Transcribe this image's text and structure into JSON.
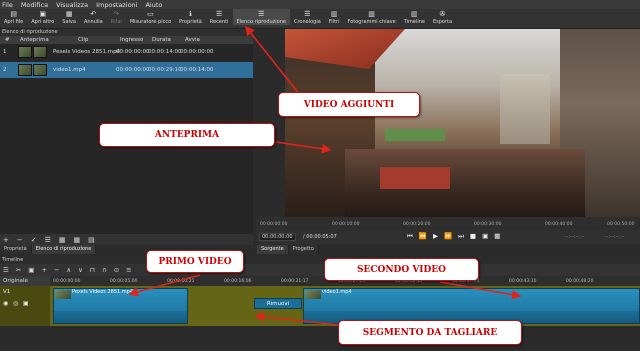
{
  "menu": [
    "File",
    "Modifica",
    "Visualizza",
    "Impostazioni",
    "Aiuto"
  ],
  "toolbar": [
    {
      "icon": "▤",
      "label": "Apri file",
      "name": "open-file-button"
    },
    {
      "icon": "▣",
      "label": "Apri altro",
      "name": "open-other-button"
    },
    {
      "icon": "▦",
      "label": "Salva",
      "name": "save-button"
    },
    {
      "icon": "↶",
      "label": "Annulla",
      "name": "undo-button"
    },
    {
      "icon": "↷",
      "label": "Rifai",
      "name": "redo-button"
    },
    {
      "icon": "▭",
      "label": "Misuratore picco",
      "name": "peak-meter-button"
    },
    {
      "icon": "ℹ",
      "label": "Proprietà",
      "name": "properties-button"
    },
    {
      "icon": "☰",
      "label": "Recenti",
      "name": "recent-button"
    },
    {
      "icon": "☰",
      "label": "Elenco riproduzione",
      "name": "playlist-button"
    },
    {
      "icon": "☰",
      "label": "Cronologia",
      "name": "history-button"
    },
    {
      "icon": "▥",
      "label": "Filtri",
      "name": "filters-button"
    },
    {
      "icon": "▥",
      "label": "Fotogrammi chiave",
      "name": "keyframes-button"
    },
    {
      "icon": "▥",
      "label": "Timeline",
      "name": "timeline-button"
    },
    {
      "icon": "✇",
      "label": "Esporta",
      "name": "export-button"
    }
  ],
  "playlist": {
    "title": "Elenco di riproduzione",
    "headers": {
      "num": "#",
      "thumb": "Anteprima",
      "clip": "Clip",
      "in": "Ingresso",
      "dur": "Durata",
      "start": "Avvia"
    },
    "rows": [
      {
        "num": "1",
        "clip": "Pexels Videos 2851.mp4",
        "in": "00:00:00:00",
        "dur": "00:00:14:00",
        "start": "00:00:00:00"
      },
      {
        "num": "2",
        "clip": "video1.mp4",
        "in": "00:00:00:00",
        "dur": "00:00:29:10",
        "start": "00:00:14:00"
      }
    ]
  },
  "playlist_buttons": [
    "+",
    "−",
    "✓",
    "☰",
    "▦",
    "▦",
    "▤"
  ],
  "left_tabs": [
    "Proprietà",
    "Elenco di riproduzione"
  ],
  "preview": {
    "ruler": [
      "00:00:00:00",
      "00:00:10:00",
      "00:00:20:00",
      "00:00:30:00",
      "00:00:40:00",
      "00:00:50:00"
    ],
    "timecode": "00:00:00:00",
    "duration": "/ 00:00:05:07",
    "transport": [
      "⏮",
      "⏪",
      "▶",
      "⏩",
      "⏭",
      "■",
      "▣",
      "▦"
    ],
    "right_tc1": "--:--:--:--",
    "right_tc2": "--:--:--:--",
    "tabs": [
      "Sorgente",
      "Progetto"
    ]
  },
  "timeline": {
    "title": "Timeline",
    "tools": [
      "☰",
      "✂",
      "▣",
      "+",
      "−",
      "∧",
      "∨",
      "⊓",
      "∩",
      "⊙",
      "≡"
    ],
    "header": "Originale",
    "track": "V1",
    "ruler": [
      "00:00:00:00",
      "00:00:05:00",
      "00:00:10:21",
      "00:00:16:06",
      "00:00:21:17",
      "00:00:27:03",
      "00:00:32:13",
      "00:00:37:24",
      "00:00:43:10",
      "00:00:48:20"
    ],
    "clip1": "Pexels Videos 2851.mp4",
    "clip2": "video1.mp4",
    "rimuovi": "Rimuovi"
  },
  "callouts": {
    "video_aggiunti": "VIDEO AGGIUNTI",
    "anteprima": "ANTEPRIMA",
    "primo_video": "PRIMO VIDEO",
    "secondo_video": "SECONDO VIDEO",
    "segmento": "SEGMENTO DA TAGLIARE"
  },
  "colors": {
    "accent": "#2f6f9a",
    "callout_text": "#cc0000",
    "track": "#646615",
    "clip": "#2a8fbd"
  }
}
